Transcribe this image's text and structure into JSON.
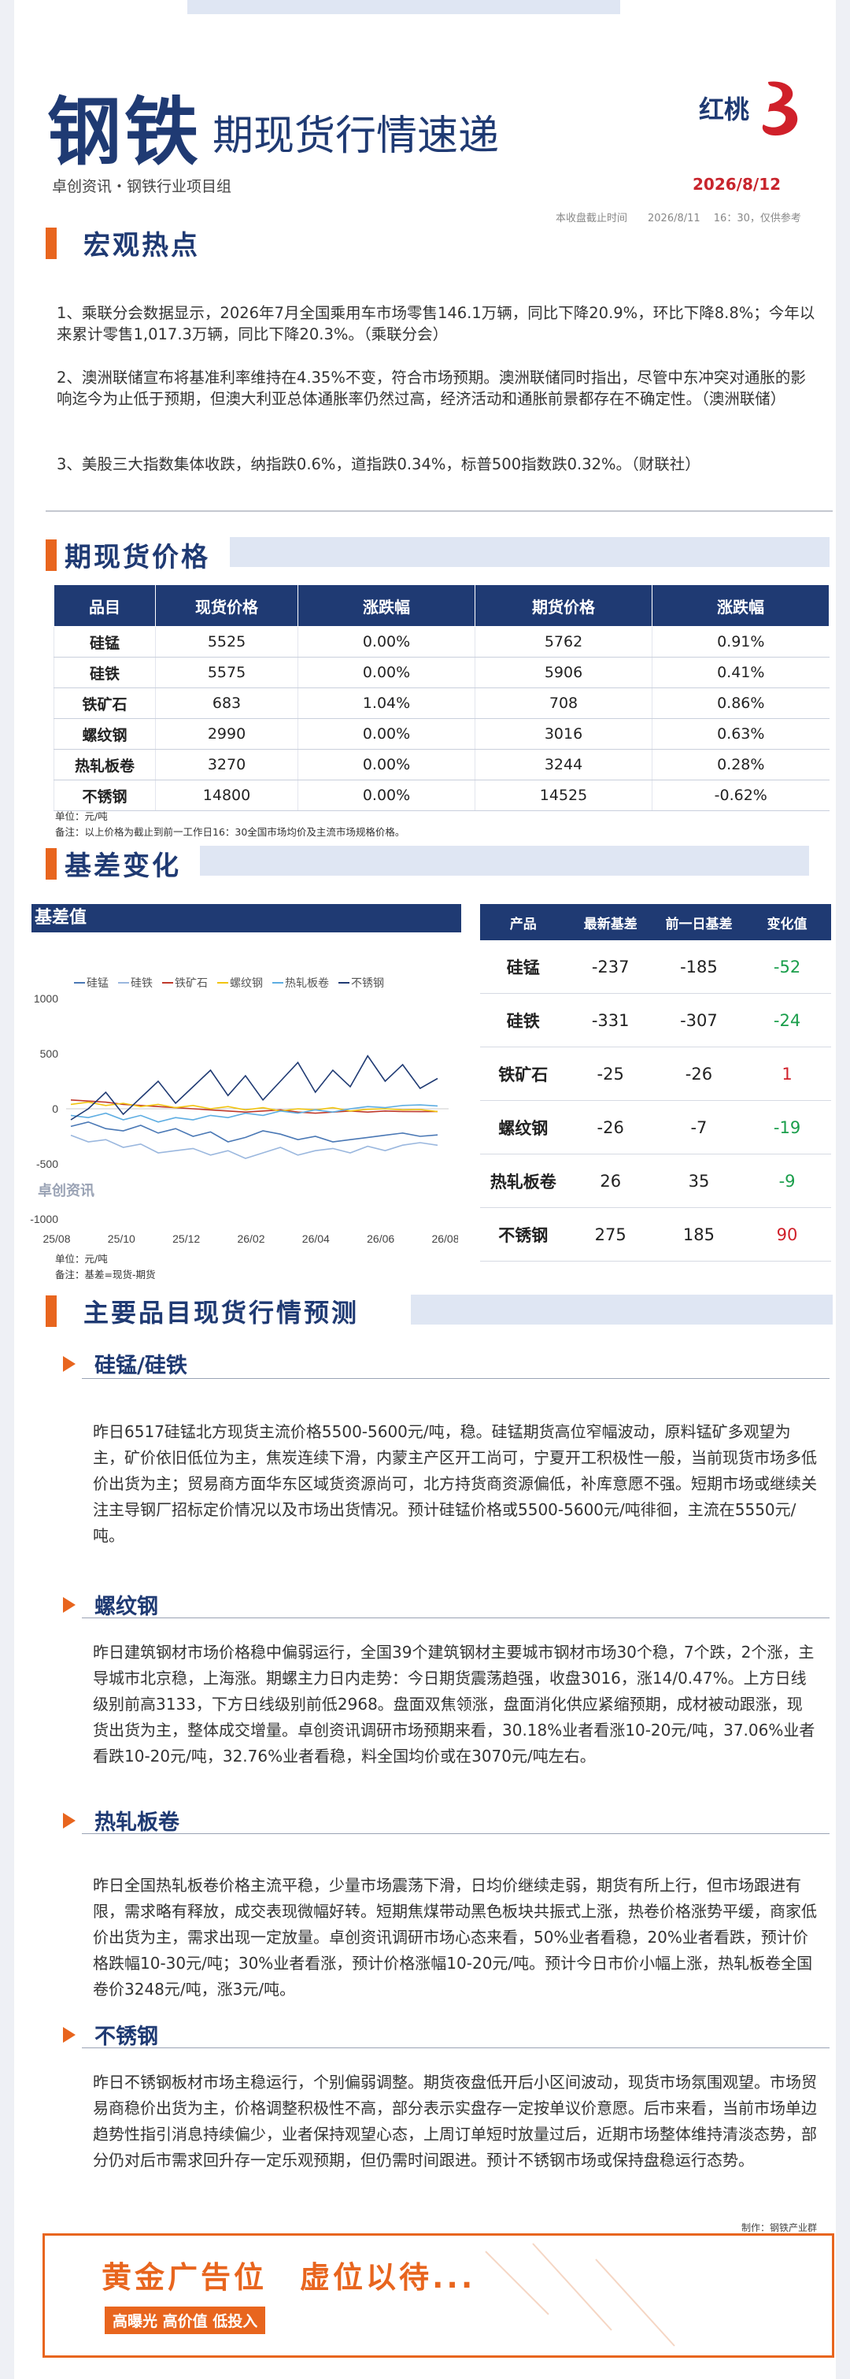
{
  "header": {
    "title_main": "钢铁",
    "title_sub": "期现货行情速递",
    "org": "卓创资讯・钢铁行业项目组",
    "logo_text": "红桃",
    "date": "2026/8/12",
    "time_note": "本收盘截止时间　　2026/8/11　 16：30，仅供参考"
  },
  "macro": {
    "title": "宏观热点",
    "items": [
      "1、乘联分会数据显示，2026年7月全国乘用车市场零售146.1万辆，同比下降20.9%，环比下降8.8%；今年以来累计零售1,017.3万辆，同比下降20.3%。（乘联分会）",
      "2、澳洲联储宣布将基准利率维持在4.35%不变，符合市场预期。澳洲联储同时指出，尽管中东冲突对通胀的影响迄今为止低于预期，但澳大利亚总体通胀率仍然过高，经济活动和通胀前景都存在不确定性。（澳洲联储）",
      "3、美股三大指数集体收跌，纳指跌0.6%，道指跌0.34%，标普500指数跌0.32%。（财联社）"
    ]
  },
  "prices": {
    "title": "期现货价格",
    "headers": [
      "品目",
      "现货价格",
      "涨跌幅",
      "期货价格",
      "涨跌幅"
    ],
    "rows": [
      [
        "硅锰",
        "5525",
        "0.00%",
        "5762",
        "0.91%"
      ],
      [
        "硅铁",
        "5575",
        "0.00%",
        "5906",
        "0.41%"
      ],
      [
        "铁矿石",
        "683",
        "1.04%",
        "708",
        "0.86%"
      ],
      [
        "螺纹钢",
        "2990",
        "0.00%",
        "3016",
        "0.63%"
      ],
      [
        "热轧板卷",
        "3270",
        "0.00%",
        "3244",
        "0.28%"
      ],
      [
        "不锈钢",
        "14800",
        "0.00%",
        "14525",
        "-0.62%"
      ]
    ],
    "unit_note": "单位：元/吨",
    "remark": "备注：以上价格为截止到前一工作日16：30全国市场均价及主流市场规格价格。"
  },
  "basis": {
    "title": "基差变化",
    "chart_title": "基差值",
    "headers": [
      "产品",
      "最新基差",
      "前一日基差",
      "变化值"
    ],
    "rows": [
      [
        "硅锰",
        "-237",
        "-185",
        "-52"
      ],
      [
        "硅铁",
        "-331",
        "-307",
        "-24"
      ],
      [
        "铁矿石",
        "-25",
        "-26",
        "1"
      ],
      [
        "螺纹钢",
        "-26",
        "-7",
        "-19"
      ],
      [
        "热轧板卷",
        "26",
        "35",
        "-9"
      ],
      [
        "不锈钢",
        "275",
        "185",
        "90"
      ]
    ],
    "change_colors": [
      "#1a9e4b",
      "#1a9e4b",
      "#d0202a",
      "#1a9e4b",
      "#1a9e4b",
      "#d0202a"
    ],
    "unit_note": "单位：元/吨",
    "remark": "备注：基差=现货-期货",
    "watermark": "卓创资讯"
  },
  "chart_data": {
    "type": "line",
    "title": "基差值",
    "x_ticks": [
      "25/08",
      "25/10",
      "25/12",
      "26/02",
      "26/04",
      "26/06",
      "26/08"
    ],
    "y_ticks": [
      "1000",
      "500",
      "0",
      "-500",
      "-1000"
    ],
    "ylim": [
      -1000,
      1000
    ],
    "legend_position": "top",
    "series": [
      {
        "name": "硅锰",
        "color": "#4a78b5",
        "values": [
          -160,
          -120,
          -180,
          -200,
          -150,
          -220,
          -180,
          -250,
          -210,
          -300,
          -260,
          -200,
          -230,
          -280,
          -250,
          -300,
          -280,
          -260,
          -240,
          -220,
          -250,
          -237
        ]
      },
      {
        "name": "硅铁",
        "color": "#9ab7de",
        "values": [
          -240,
          -300,
          -280,
          -350,
          -320,
          -400,
          -380,
          -360,
          -420,
          -380,
          -450,
          -400,
          -350,
          -420,
          -380,
          -360,
          -400,
          -340,
          -380,
          -330,
          -307,
          -331
        ]
      },
      {
        "name": "铁矿石",
        "color": "#c0392b",
        "values": [
          80,
          70,
          60,
          40,
          30,
          20,
          10,
          0,
          -10,
          -20,
          -30,
          -20,
          -10,
          -30,
          -40,
          -30,
          -20,
          -30,
          -20,
          -25,
          -26,
          -25
        ]
      },
      {
        "name": "螺纹钢",
        "color": "#f1c40f",
        "values": [
          40,
          60,
          30,
          50,
          20,
          40,
          10,
          30,
          0,
          20,
          -10,
          10,
          -20,
          0,
          -10,
          10,
          -20,
          -5,
          0,
          -10,
          -7,
          -26
        ]
      },
      {
        "name": "热轧板卷",
        "color": "#5dade2",
        "values": [
          -60,
          -80,
          -40,
          -100,
          -60,
          -120,
          -80,
          -100,
          -60,
          -80,
          -40,
          -60,
          -20,
          -40,
          -10,
          -30,
          0,
          20,
          10,
          30,
          35,
          26
        ]
      },
      {
        "name": "不锈钢",
        "color": "#1f3a73",
        "values": [
          -100,
          0,
          150,
          -50,
          100,
          250,
          50,
          200,
          350,
          120,
          300,
          80,
          250,
          420,
          150,
          350,
          200,
          480,
          250,
          400,
          185,
          275
        ]
      }
    ]
  },
  "forecast": {
    "title": "主要品目现货行情预测",
    "sections": [
      {
        "title": "硅锰/硅铁",
        "text": "昨日6517硅锰北方现货主流价格5500-5600元/吨，稳。硅锰期货高位窄幅波动，原料锰矿多观望为主，矿价依旧低位为主，焦炭连续下滑，内蒙主产区开工尚可，宁夏开工积极性一般，当前现货市场多低价出货为主；贸易商方面华东区域货资源尚可，北方持货商资源偏低，补库意愿不强。短期市场或继续关注主导钢厂招标定价情况以及市场出货情况。预计硅锰价格或5500-5600元/吨徘徊，主流在5550元/吨。"
      },
      {
        "title": "螺纹钢",
        "text": "昨日建筑钢材市场价格稳中偏弱运行，全国39个建筑钢材主要城市钢材市场30个稳，7个跌，2个涨，主导城市北京稳，上海涨。期螺主力日内走势：今日期货震荡趋强，收盘3016，涨14/0.47%。上方日线级别前高3133，下方日线级别前低2968。盘面双焦领涨，盘面消化供应紧缩预期，成材被动跟涨，现货出货为主，整体成交增量。卓创资讯调研市场预期来看，30.18%业者看涨10-20元/吨，37.06%业者看跌10-20元/吨，32.76%业者看稳，料全国均价或在3070元/吨左右。"
      },
      {
        "title": "热轧板卷",
        "text": "昨日全国热轧板卷价格主流平稳，少量市场震荡下滑，日均价继续走弱，期货有所上行，但市场跟进有限，需求略有释放，成交表现微幅好转。短期焦煤带动黑色板块共振式上涨，热卷价格涨势平缓，商家低价出货为主，需求出现一定放量。卓创资讯调研市场心态来看，50%业者看稳，20%业者看跌，预计价格跌幅10-30元/吨；30%业者看涨，预计价格涨幅10-20元/吨。预计今日市价小幅上涨，热轧板卷全国卷价3248元/吨，涨3元/吨。"
      },
      {
        "title": "不锈钢",
        "text": "昨日不锈钢板材市场主稳运行，个别偏弱调整。期货夜盘低开后小区间波动，现货市场氛围观望。市场贸易商稳价出货为主，价格调整积极性不高，部分表示实盘存一定按单议价意愿。后市来看，当前市场单边趋势性指引消息持续偏少，业者保持观望心态，上周订单短时放量过后，近期市场整体维持清淡态势，部分仍对后市需求回升存一定乐观预期，但仍需时间跟进。预计不锈钢市场或保持盘稳运行态势。"
      }
    ],
    "maker": "制作：钢铁产业群"
  },
  "ad": {
    "title": "黄金广告位　虚位以待...",
    "badge": "高曝光 高价值 低投入"
  }
}
